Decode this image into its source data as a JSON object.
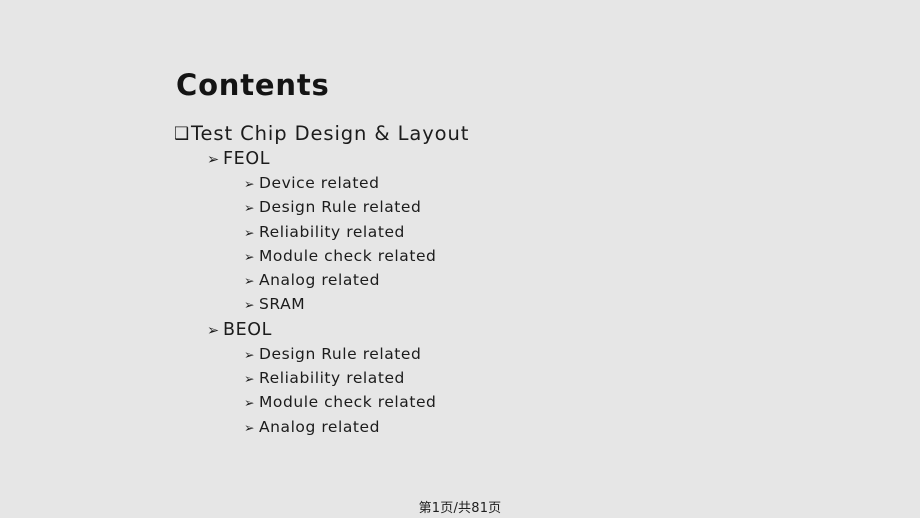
{
  "slide": {
    "title": "Contents",
    "background_color": "#e6e6e6",
    "text_color": "#1c1c1c",
    "bullets": {
      "level1_glyph": "❑",
      "level2_glyph": "➢",
      "level3_glyph": "➢"
    },
    "outline": [
      {
        "level": 1,
        "bullet": "❑",
        "label": "Test Chip Design & Layout"
      },
      {
        "level": 2,
        "bullet": "➢",
        "label": "FEOL"
      },
      {
        "level": 3,
        "bullet": "➢",
        "label": "Device related"
      },
      {
        "level": 3,
        "bullet": "➢",
        "label": "Design Rule related"
      },
      {
        "level": 3,
        "bullet": "➢",
        "label": "Reliability related"
      },
      {
        "level": 3,
        "bullet": "➢",
        "label": "Module check related"
      },
      {
        "level": 3,
        "bullet": "➢",
        "label": "Analog related"
      },
      {
        "level": 3,
        "bullet": "➢",
        "label": "SRAM"
      },
      {
        "level": 2,
        "bullet": "➢",
        "label": "BEOL"
      },
      {
        "level": 3,
        "bullet": "➢",
        "label": "Design Rule related"
      },
      {
        "level": 3,
        "bullet": "➢",
        "label": "Reliability related"
      },
      {
        "level": 3,
        "bullet": "➢",
        "label": "Module check related"
      },
      {
        "level": 3,
        "bullet": "➢",
        "label": "Analog related"
      }
    ]
  },
  "footer": {
    "page_indicator": "第1页/共81页",
    "current_page": 1,
    "total_pages": 81
  }
}
